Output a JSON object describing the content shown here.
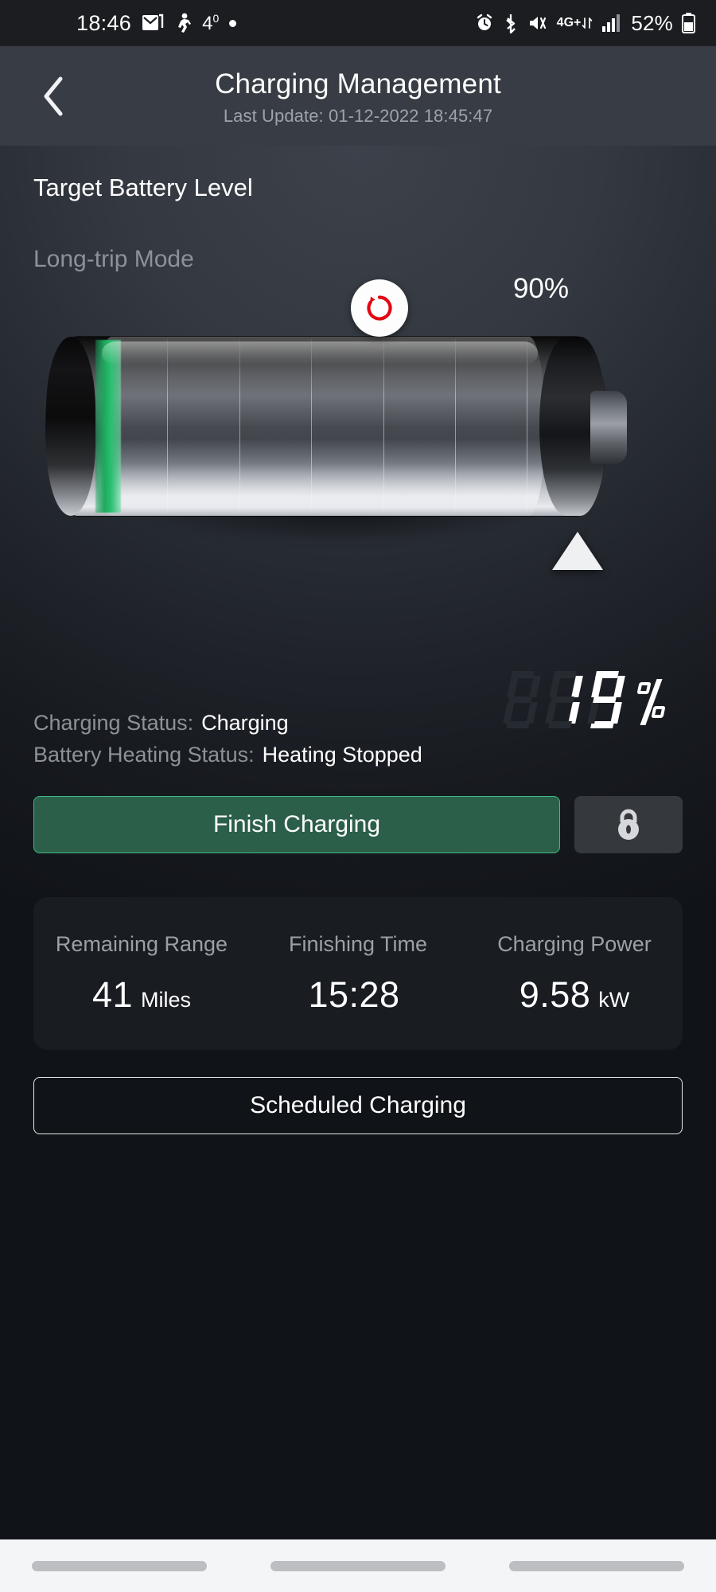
{
  "status_bar": {
    "time": "18:46",
    "temperature": "4",
    "temperature_degree": "0",
    "network_label": "4G+",
    "battery_percent": "52%",
    "icons": [
      "email-icon",
      "running-person-icon",
      "dot-icon",
      "alarm-icon",
      "bluetooth-icon",
      "mute-vibrate-icon",
      "data-transfer-icon",
      "signal-bars-icon",
      "battery-icon"
    ]
  },
  "header": {
    "back_label": "back",
    "title": "Charging Management",
    "subtitle": "Last Update: 01-12-2022 18:45:47"
  },
  "main": {
    "section_title": "Target Battery Level",
    "mode_label": "Long-trip Mode",
    "target_percent": "90%",
    "refresh_label": "reset",
    "slider_label": "target level handle"
  },
  "readout": {
    "digits": [
      "8",
      "1",
      "9"
    ],
    "digits_lit": [
      false,
      true,
      true
    ],
    "unit": "%",
    "value": "19"
  },
  "status": {
    "charging_key": "Charging Status:",
    "charging_value": "Charging",
    "heating_key": "Battery Heating Status:",
    "heating_value": "Heating Stopped"
  },
  "actions": {
    "finish_label": "Finish Charging",
    "lock_label": "lock",
    "scheduled_label": "Scheduled Charging"
  },
  "stats": [
    {
      "label": "Remaining Range",
      "value": "41",
      "unit": "Miles"
    },
    {
      "label": "Finishing Time",
      "value": "15:28",
      "unit": ""
    },
    {
      "label": "Charging Power",
      "value": "9.58",
      "unit": "kW"
    }
  ],
  "colors": {
    "accent_green": "#3fbb85",
    "button_green": "#2c5f4a",
    "refresh_red": "#e30613",
    "battery_fill": "#2cc071",
    "header_bg": "#383c44",
    "card_bg": "#191c21"
  }
}
